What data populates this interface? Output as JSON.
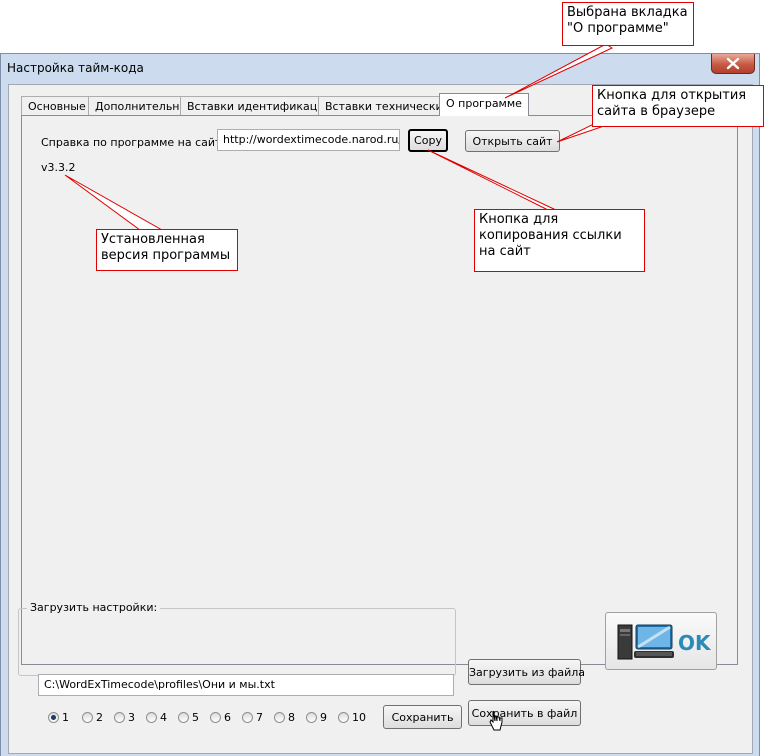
{
  "window": {
    "title": "Настройка тайм-кода"
  },
  "tabs": [
    {
      "label": "Основные"
    },
    {
      "label": "Дополнительно"
    },
    {
      "label": "Вставки идентификации"
    },
    {
      "label": "Вставки технические"
    },
    {
      "label": "О программе",
      "active": true
    }
  ],
  "about": {
    "help_label": "Справка по программе на сайте:",
    "url": "http://wordextimecode.narod.ru/",
    "copy_button": "Copy",
    "open_site_button": "Открыть сайт",
    "version": "v3.3.2"
  },
  "settings": {
    "group_label": "Загрузить настройки:",
    "path": "C:\\WordExTimecode\\profiles\\Они и мы.txt",
    "slots": [
      "1",
      "2",
      "3",
      "4",
      "5",
      "6",
      "7",
      "8",
      "9",
      "10"
    ],
    "selected_slot": "1",
    "save_button": "Сохранить",
    "load_from_file_button": "Загрузить из файла",
    "save_to_file_button": "Сохранить в файл",
    "ok_button": "OK"
  },
  "annotations": {
    "tab_selected": "Выбрана вкладка \"О программе\"",
    "open_site": "Кнопка для открытия сайта в браузере",
    "copy_link": "Кнопка для копирования ссылки на сайт",
    "version": "Установленная версия программы"
  },
  "colors": {
    "annotation_border": "#e00000",
    "ok_accent": "#2a8ab8"
  }
}
